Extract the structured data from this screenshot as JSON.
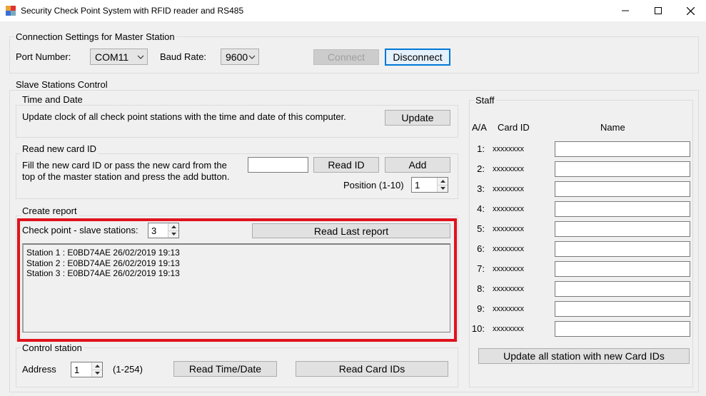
{
  "window": {
    "title": "Security Check Point System with RFID reader and RS485",
    "minimize_icon": "minimize-icon",
    "maximize_icon": "maximize-icon",
    "close_icon": "close-icon"
  },
  "connection": {
    "title": "Connection Settings for Master Station",
    "port_label": "Port Number:",
    "port_value": "COM11",
    "baud_label": "Baud Rate:",
    "baud_value": "9600",
    "connect_label": "Connect",
    "disconnect_label": "Disconnect"
  },
  "slave": {
    "title": "Slave Stations Control",
    "time_date": {
      "title": "Time and Date",
      "description": "Update clock of all check point stations with the time and date of this computer.",
      "update_label": "Update"
    },
    "read_card": {
      "title": "Read new card ID",
      "description_line1": "Fill the new card ID or pass the new card from the",
      "description_line2": "top of the master station and press the add button.",
      "card_id_value": "",
      "read_id_label": "Read ID",
      "add_label": "Add",
      "position_label": "Position (1-10)",
      "position_value": "1"
    },
    "report": {
      "title": "Create report",
      "checkpoint_label": "Check point - slave stations:",
      "checkpoint_value": "3",
      "read_last_label": "Read Last report",
      "lines": [
        "Station 1 : E0BD74AE 26/02/2019 19:13",
        "Station 2 : E0BD74AE 26/02/2019 19:13",
        "Station 3 : E0BD74AE 26/02/2019 19:13"
      ]
    },
    "control": {
      "title": "Control station",
      "address_label": "Address",
      "address_value": "1",
      "range_label": "(1-254)",
      "read_time_label": "Read Time/Date",
      "read_cards_label": "Read Card IDs"
    }
  },
  "staff": {
    "title": "Staff",
    "col_aa": "A/A",
    "col_card": "Card ID",
    "col_name": "Name",
    "rows": [
      {
        "num": "1:",
        "card": "xxxxxxxx",
        "name": ""
      },
      {
        "num": "2:",
        "card": "xxxxxxxx",
        "name": ""
      },
      {
        "num": "3:",
        "card": "xxxxxxxx",
        "name": ""
      },
      {
        "num": "4:",
        "card": "xxxxxxxx",
        "name": ""
      },
      {
        "num": "5:",
        "card": "xxxxxxxx",
        "name": ""
      },
      {
        "num": "6:",
        "card": "xxxxxxxx",
        "name": ""
      },
      {
        "num": "7:",
        "card": "xxxxxxxx",
        "name": ""
      },
      {
        "num": "8:",
        "card": "xxxxxxxx",
        "name": ""
      },
      {
        "num": "9:",
        "card": "xxxxxxxx",
        "name": ""
      },
      {
        "num": "10:",
        "card": "xxxxxxxx",
        "name": ""
      }
    ],
    "update_all_label": "Update all station with new Card IDs"
  },
  "colors": {
    "highlight": "#e0121d",
    "focus": "#0078d7"
  }
}
